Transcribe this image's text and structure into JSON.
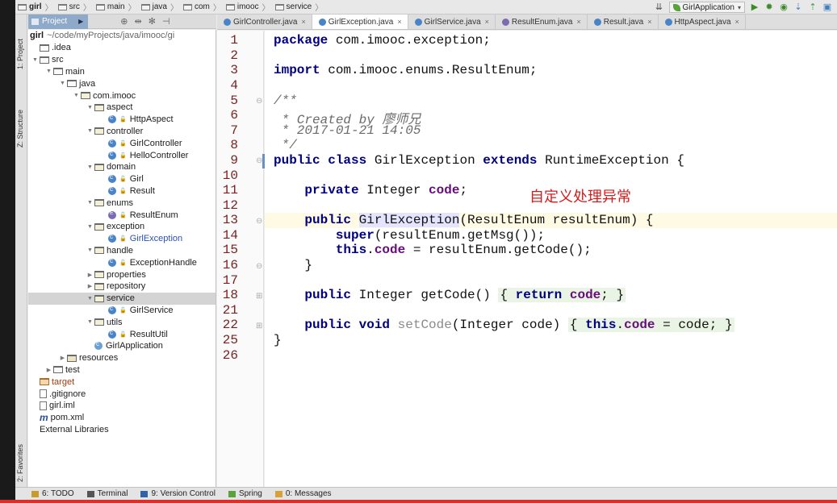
{
  "breadcrumbs": [
    "girl",
    "src",
    "main",
    "java",
    "com",
    "imooc",
    "service"
  ],
  "run_config": "GirlApplication",
  "project_panel": {
    "tab_label": "Project",
    "root_label": "girl",
    "root_path": "~/code/myProjects/java/imooc/gi"
  },
  "tree": [
    {
      "label": ".idea",
      "depth": 0,
      "kind": "folder",
      "arrow": ""
    },
    {
      "label": "src",
      "depth": 0,
      "kind": "folder",
      "arrow": "▼"
    },
    {
      "label": "main",
      "depth": 1,
      "kind": "folder",
      "arrow": "▼"
    },
    {
      "label": "java",
      "depth": 2,
      "kind": "folder",
      "arrow": "▼"
    },
    {
      "label": "com.imooc",
      "depth": 3,
      "kind": "pkg",
      "arrow": "▼"
    },
    {
      "label": "aspect",
      "depth": 4,
      "kind": "pkg",
      "arrow": "▼"
    },
    {
      "label": "HttpAspect",
      "depth": 5,
      "kind": "class",
      "arrow": ""
    },
    {
      "label": "controller",
      "depth": 4,
      "kind": "pkg",
      "arrow": "▼"
    },
    {
      "label": "GirlController",
      "depth": 5,
      "kind": "class",
      "arrow": ""
    },
    {
      "label": "HelloController",
      "depth": 5,
      "kind": "class",
      "arrow": ""
    },
    {
      "label": "domain",
      "depth": 4,
      "kind": "pkg",
      "arrow": "▼"
    },
    {
      "label": "Girl",
      "depth": 5,
      "kind": "class",
      "arrow": ""
    },
    {
      "label": "Result",
      "depth": 5,
      "kind": "class",
      "arrow": ""
    },
    {
      "label": "enums",
      "depth": 4,
      "kind": "pkg",
      "arrow": "▼"
    },
    {
      "label": "ResultEnum",
      "depth": 5,
      "kind": "enum",
      "arrow": ""
    },
    {
      "label": "exception",
      "depth": 4,
      "kind": "pkg",
      "arrow": "▼"
    },
    {
      "label": "GirlException",
      "depth": 5,
      "kind": "class-open",
      "arrow": ""
    },
    {
      "label": "handle",
      "depth": 4,
      "kind": "pkg",
      "arrow": "▼"
    },
    {
      "label": "ExceptionHandle",
      "depth": 5,
      "kind": "class",
      "arrow": ""
    },
    {
      "label": "properties",
      "depth": 4,
      "kind": "pkg",
      "arrow": "▶"
    },
    {
      "label": "repository",
      "depth": 4,
      "kind": "pkg",
      "arrow": "▶"
    },
    {
      "label": "service",
      "depth": 4,
      "kind": "pkg",
      "arrow": "▼",
      "selected": true
    },
    {
      "label": "GirlService",
      "depth": 5,
      "kind": "class",
      "arrow": ""
    },
    {
      "label": "utils",
      "depth": 4,
      "kind": "pkg",
      "arrow": "▼"
    },
    {
      "label": "ResultUtil",
      "depth": 5,
      "kind": "class",
      "arrow": ""
    },
    {
      "label": "GirlApplication",
      "depth": 4,
      "kind": "app",
      "arrow": ""
    },
    {
      "label": "resources",
      "depth": 2,
      "kind": "res",
      "arrow": "▶"
    },
    {
      "label": "test",
      "depth": 1,
      "kind": "folder",
      "arrow": "▶"
    },
    {
      "label": "target",
      "depth": 0,
      "kind": "target",
      "arrow": ""
    },
    {
      "label": ".gitignore",
      "depth": 0,
      "kind": "file",
      "arrow": ""
    },
    {
      "label": "girl.iml",
      "depth": 0,
      "kind": "file",
      "arrow": ""
    },
    {
      "label": "pom.xml",
      "depth": 0,
      "kind": "maven",
      "arrow": ""
    },
    {
      "label": "External Libraries",
      "depth": 0,
      "kind": "lib",
      "arrow": ""
    }
  ],
  "tabs": [
    {
      "label": "GirlController.java",
      "kind": "class",
      "active": false
    },
    {
      "label": "GirlException.java",
      "kind": "class",
      "active": true
    },
    {
      "label": "GirlService.java",
      "kind": "class",
      "active": false
    },
    {
      "label": "ResultEnum.java",
      "kind": "enum",
      "active": false
    },
    {
      "label": "Result.java",
      "kind": "class",
      "active": false
    },
    {
      "label": "HttpAspect.java",
      "kind": "class",
      "active": false
    }
  ],
  "line_numbers": [
    "1",
    "2",
    "3",
    "4",
    "5",
    "6",
    "7",
    "8",
    "9",
    "10",
    "11",
    "12",
    "13",
    "14",
    "15",
    "16",
    "17",
    "18",
    "21",
    "22",
    "25",
    "26"
  ],
  "code": {
    "l1_kw": "package",
    "l1_rest": " com.imooc.exception;",
    "l3_kw": "import",
    "l3_rest": " com.imooc.enums.ResultEnum;",
    "l5": "/**",
    "l6": " * Created by 廖师兄",
    "l7": " * 2017-01-21 14:05",
    "l8": " */",
    "l9_kw1": "public",
    "l9_kw2": "class",
    "l9_name": "GirlException",
    "l9_kw3": "extends",
    "l9_rest": " RuntimeException {",
    "l11_kw": "private",
    "l11_type": " Integer ",
    "l11_field": "code",
    "l11_end": ";",
    "l13_kw": "public",
    "l13_name": "GirlException",
    "l13_rest": "(ResultEnum resultEnum) {",
    "l14_kw": "super",
    "l14_rest": "(resultEnum.getMsg());",
    "l15_kw": "this",
    "l15_field": "code",
    "l15_rest": " = resultEnum.getCode();",
    "l16": "}",
    "l18_kw": "public",
    "l18_rest": " Integer getCode() ",
    "l18_brace_open": "{ ",
    "l18_ret": "return",
    "l18_field": " code",
    "l18_semi": "; ",
    "l18_brace_close": "}",
    "l22_kw1": "public",
    "l22_kw2": "void",
    "l22_name": "setCode",
    "l22_rest": "(Integer code) ",
    "l22_brace_open": "{ ",
    "l22_this": "this",
    "l22_field": "code",
    "l22_assign": " = code; ",
    "l22_brace_close": "}",
    "l25": "}"
  },
  "annotation": "自定义处理异常",
  "side_labels": {
    "project": "1: Project",
    "structure": "Z: Structure",
    "favorites": "2: Favorites"
  },
  "bottom_tools": [
    "6: TODO",
    "Terminal",
    "9: Version Control",
    "Spring",
    "0: Messages"
  ]
}
